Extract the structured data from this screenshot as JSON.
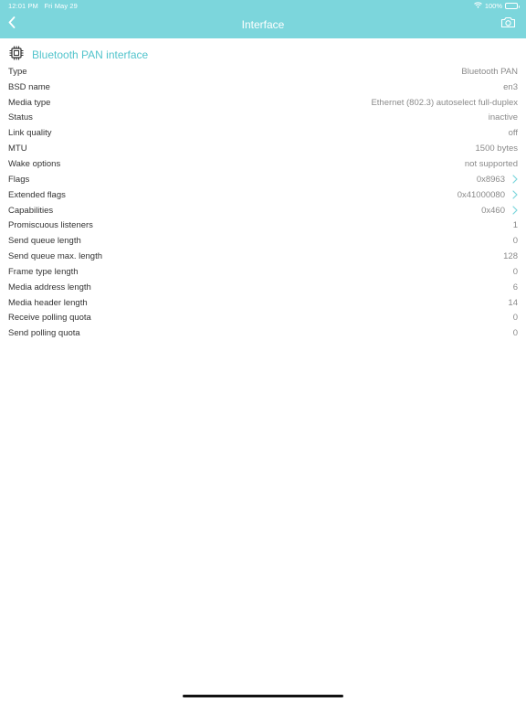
{
  "status_bar": {
    "time": "12:01 PM",
    "date": "Fri May 29",
    "battery_text": "100%",
    "battery_level": 1.0
  },
  "nav": {
    "title": "Interface",
    "back_icon": "chevron-left-icon",
    "camera_icon": "camera-icon"
  },
  "section": {
    "icon": "chip-icon",
    "title": "Bluetooth PAN interface"
  },
  "colors": {
    "accent": "#7cd6dc",
    "accent_text": "#52c4cc",
    "label": "#333333",
    "value": "#8a8a8a"
  },
  "rows": [
    {
      "label": "Type",
      "value": "Bluetooth PAN"
    },
    {
      "label": "BSD name",
      "value": "en3"
    },
    {
      "label": "Media type",
      "value": "Ethernet (802.3) autoselect full-duplex"
    },
    {
      "label": "Status",
      "value": "inactive"
    },
    {
      "label": "Link quality",
      "value": "off"
    },
    {
      "label": "MTU",
      "value": "1500 bytes"
    },
    {
      "label": "Wake options",
      "value": "not supported"
    },
    {
      "label": "Flags",
      "value": "0x8963"
    },
    {
      "label": "Extended flags",
      "value": "0x41000080"
    },
    {
      "label": "Capabilities",
      "value": "0x460"
    },
    {
      "label": "Promiscuous listeners",
      "value": "1"
    },
    {
      "label": "Send queue length",
      "value": "0"
    },
    {
      "label": "Send queue max. length",
      "value": "128"
    },
    {
      "label": "Frame type length",
      "value": "0"
    },
    {
      "label": "Media address length",
      "value": "6"
    },
    {
      "label": "Media header length",
      "value": "14"
    },
    {
      "label": "Receive polling quota",
      "value": "0"
    },
    {
      "label": "Send polling quota",
      "value": "0"
    }
  ]
}
